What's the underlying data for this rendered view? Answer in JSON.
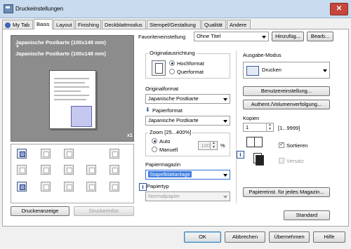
{
  "window": {
    "title": "Druckeinstellungen",
    "close": "✕"
  },
  "tabs": [
    "My Tab",
    "Basis",
    "Layout",
    "Finishing",
    "Deckblattmodus",
    "Stempel/Gestaltung",
    "Qualität",
    "Andere"
  ],
  "favorites": {
    "label": "Favoriteneinstellung",
    "value": "Ohne Titel",
    "add": "Hinzufüg...",
    "edit": "Bearb..."
  },
  "preview": {
    "line1": "Japanische Postkarte (100x148 mm)",
    "arrow": "▼",
    "line2": "Japanische Postkarte (100x148 mm)",
    "copies_badge": "x1"
  },
  "orientation": {
    "title": "Originalausrichtung",
    "portrait": "Hochformat",
    "landscape": "Querformat",
    "selected": "Hochformat"
  },
  "original_format": {
    "label": "Originalformat",
    "value": "Japanische Postkarte"
  },
  "paper_format": {
    "label": "Papierformat",
    "value": "Japanische Postkarte"
  },
  "zoom": {
    "title": "Zoom [25...400%]",
    "auto": "Auto",
    "manual": "Manuell",
    "value": "100",
    "unit": "%"
  },
  "paper_tray": {
    "label": "Papiermagazin",
    "value": "Stapelblattanlage"
  },
  "paper_type": {
    "label": "Papiertyp",
    "value": "Normalpapier"
  },
  "output": {
    "label": "Ausgabe-Modus",
    "value": "Drucken"
  },
  "buttons": {
    "user_settings": "Benutzereinstellung...",
    "auth": "Authent./Volumenverfolgung...",
    "tray_settings": "Papiereinst. für jedes Magazin...",
    "standard": "Standard",
    "printer_view": "Druckeranzeige",
    "printer_info": "Druckerinfos"
  },
  "copies": {
    "label": "Kopien",
    "value": "1",
    "range": "[1...9999]",
    "collate": "Sortieren",
    "offset": "Versatz"
  },
  "footer": {
    "ok": "OK",
    "cancel": "Abbrechen",
    "apply": "Übernehmen",
    "help": "Hilfe"
  }
}
